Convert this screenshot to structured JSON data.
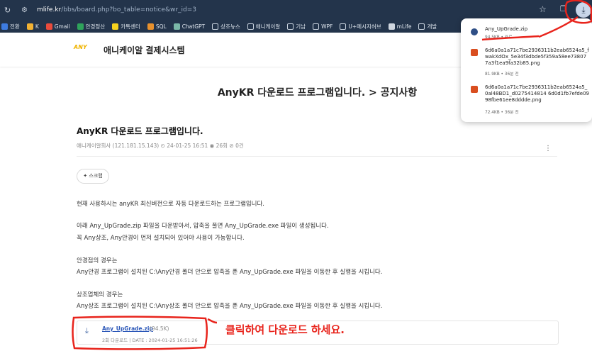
{
  "browser": {
    "url_host": "mlife.kr",
    "url_path": "/bbs/board.php?bo_table=notice&wr_id=3",
    "bookmarks": [
      "전환",
      "K",
      "Gmail",
      "안경정산",
      "카톡센터",
      "SQL",
      "ChatGPT",
      "상조뉴스",
      "애니케이알",
      "기남",
      "WPF",
      "U+메시지허브",
      "mLife",
      "개발"
    ]
  },
  "site": {
    "logo": "ANY",
    "title": "애니케이알 결제시스템"
  },
  "page_title": "AnyKR 다운로드 프로그램입니다. > 공지사항",
  "post": {
    "title": "AnyKR 다운로드 프로그램입니다.",
    "meta": "애니케이알회사 (121.181.15.143) ⊙ 24-01-25 16:51  ◉ 26회  ⊘ 0건",
    "scrap_label": "스크랩",
    "body": [
      "현재 사용하시는 anyKR 최신버전으로 자동 다운로드하는 프로그램입니다.",
      "아래 Any_UpGrade.zip 파일을 다운받아서, 압축을 풀면 Any_UpGrade.exe 파일이 생성됩니다.",
      "꼭 Any상조, Any안경이 먼저 설치되어 있어야 사용이 가능합니다.",
      "안경점의 경우는",
      "Any안경 프로그램이 설치된 C:\\Any안경 폴더 안으로 압축을 푼 Any_UpGrade.exe 파일을 이동한 후 실행을 시킵니다.",
      "상조업체의 경우는",
      "Any상조 프로그램이 설치된 C:\\Any상조 폴더 안으로 압축을 푼 Any_UpGrade.exe 파일을 이동한 후 실행을 시킵니다."
    ],
    "attachment": {
      "name": "Any_UpGrade.zip",
      "size": "(94.5K)",
      "info": "2회 다운로드 | DATE : 2024-01-25 16:51:26"
    }
  },
  "annotation_text": "클릭하여 다운로드 하세요.",
  "downloads": [
    {
      "name": "Any_UpGrade.zip",
      "sub": "94.5KB • 완료"
    },
    {
      "name_lines": [
        "6d6a0a1a71c7be2936311b2eab6524a5_f",
        "wakXdOx_5e34f3dbde5f359a58ee73807",
        "7a3f1ea9fa32b85.png"
      ],
      "sub": "81.9KB • 36분 전"
    },
    {
      "name_lines": [
        "6d6a0a1a71c7be2936311b2eab6524a5_",
        "0al48BD1_d0275414814 6d0d1fb7efde09",
        "98fbe61ee8dddde.png"
      ],
      "sub": "72.4KB • 36분 전"
    }
  ],
  "colors": {
    "chrome": "#23344b",
    "annotation": "#e8241c",
    "link": "#2b57b8"
  }
}
